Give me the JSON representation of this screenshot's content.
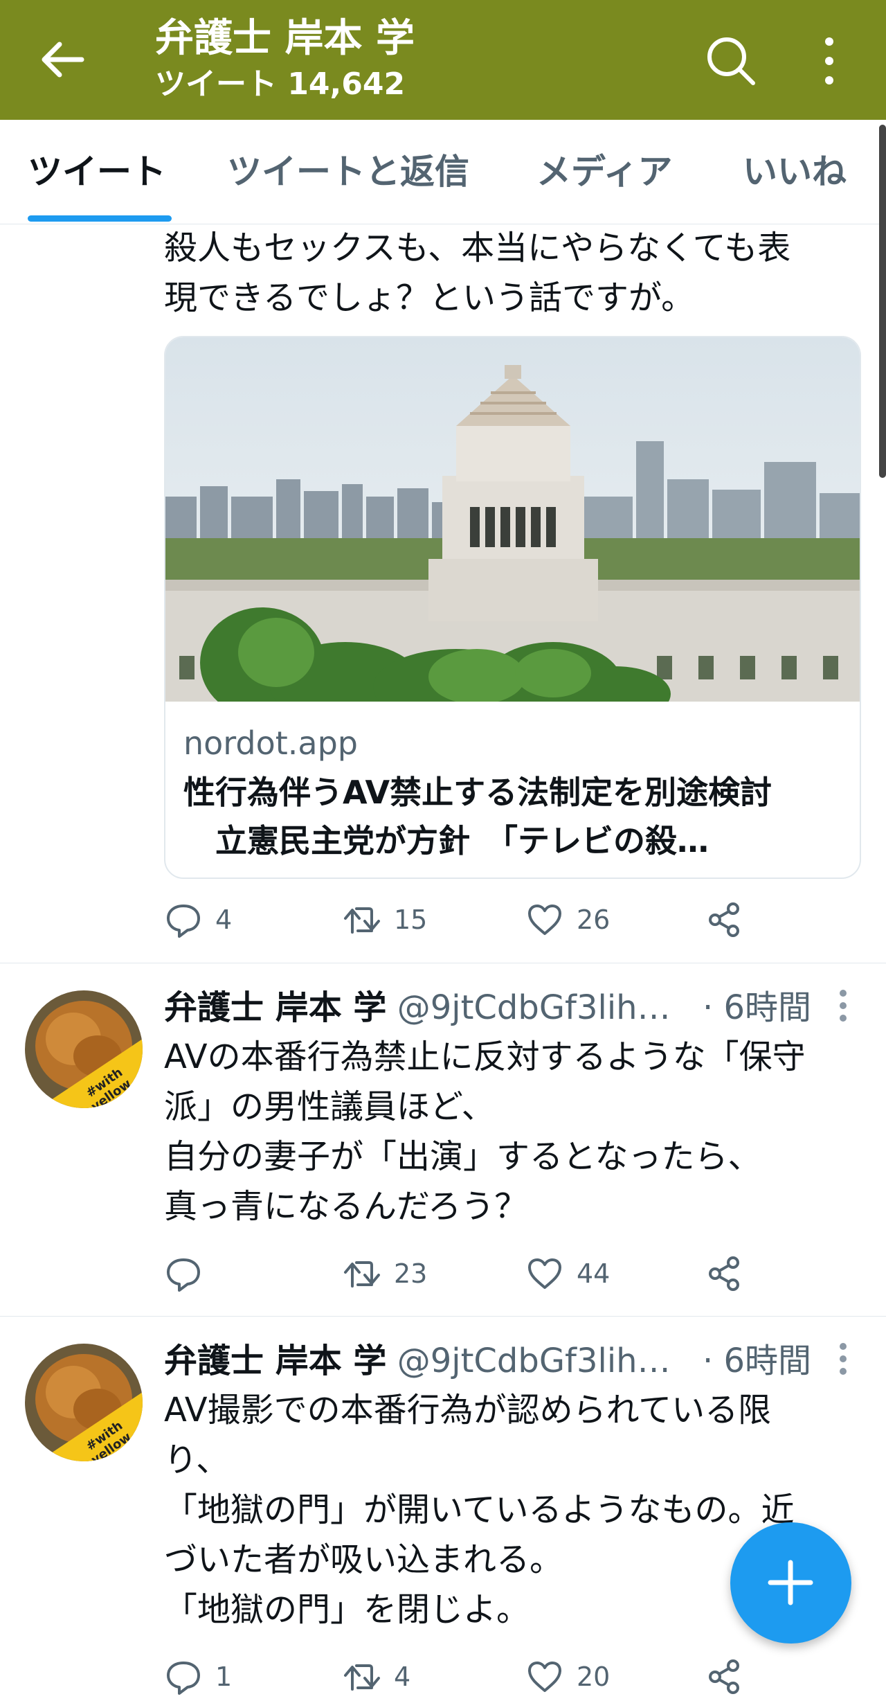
{
  "header": {
    "title": "弁護士 岸本 学",
    "tweet_count": "ツイート 14,642",
    "bg_color": "#7a8a1f"
  },
  "tabs": [
    {
      "label": "ツイート",
      "active": true
    },
    {
      "label": "ツイートと返信",
      "active": false
    },
    {
      "label": "メディア",
      "active": false
    },
    {
      "label": "いいね",
      "active": false
    }
  ],
  "tweet1": {
    "text_lines": [
      "殺人もセックスも、本当にやらなくても表",
      "現できるでしょ？という話ですが。"
    ],
    "card": {
      "domain": "nordot.app",
      "title": "性行為伴うAV禁止する法制定を別途検討\n　立憲民主党が方針　「テレビの殺…"
    },
    "actions": {
      "replies": "4",
      "retweets": "15",
      "likes": "26"
    }
  },
  "tweet2": {
    "name": "弁護士 岸本 学",
    "handle": "@9jtCdbGf3lih…",
    "time": "· 6時間",
    "text_lines": [
      "AVの本番行為禁止に反対するような「保守",
      "派」の男性議員ほど、",
      "自分の妻子が「出演」するとなったら、",
      "真っ青になるんだろう？"
    ],
    "actions": {
      "replies": "",
      "retweets": "23",
      "likes": "44"
    }
  },
  "tweet3": {
    "name": "弁護士 岸本 学",
    "handle": "@9jtCdbGf3lih…",
    "time": "· 6時間",
    "text_lines": [
      "AV撮影での本番行為が認められている限",
      "り、",
      "「地獄の門」が開いているようなもの。近",
      "づいた者が吸い込まれる。",
      "「地獄の門」を閉じよ。"
    ],
    "actions": {
      "replies": "1",
      "retweets": "4",
      "likes": "20"
    }
  },
  "avatar_badge": "#with yellow",
  "accent_color": "#1d9bf0"
}
